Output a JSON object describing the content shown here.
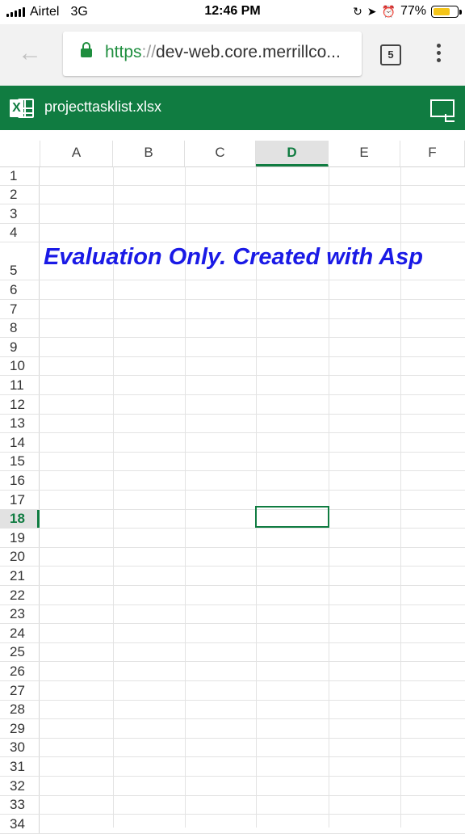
{
  "status_bar": {
    "carrier": "Airtel",
    "network": "3G",
    "time": "12:46 PM",
    "battery_percent": "77%",
    "battery_level": 0.77
  },
  "browser": {
    "url_scheme": "https",
    "url_separator": "://",
    "url_rest": "dev-web.core.merrillco...",
    "tab_count": "5"
  },
  "excel": {
    "file_name": "projecttasklist.xlsx",
    "columns": [
      "A",
      "B",
      "C",
      "D",
      "E",
      "F"
    ],
    "selected_column": "D",
    "selected_row": "18",
    "rows": [
      "1",
      "2",
      "3",
      "4",
      "5",
      "6",
      "7",
      "8",
      "9",
      "10",
      "11",
      "12",
      "13",
      "14",
      "15",
      "16",
      "17",
      "18",
      "19",
      "20",
      "21",
      "22",
      "23",
      "24",
      "25",
      "26",
      "27",
      "28",
      "29",
      "30",
      "31",
      "32",
      "33",
      "34"
    ],
    "cell_text": "Evaluation Only. Created with Asp"
  },
  "colors": {
    "excel_green": "#107c41",
    "eval_text_blue": "#1a1ae6"
  }
}
